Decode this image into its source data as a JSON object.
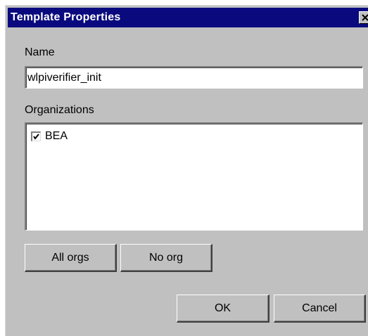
{
  "window": {
    "title": "Template Properties",
    "close_icon": "close-icon"
  },
  "form": {
    "name_label": "Name",
    "name_value": "wlpiverifier_init",
    "organizations_label": "Organizations",
    "organizations": [
      {
        "name": "BEA",
        "checked": true
      }
    ]
  },
  "buttons": {
    "all_orgs": "All orgs",
    "no_org": "No org",
    "ok": "OK",
    "cancel": "Cancel"
  },
  "colors": {
    "titlebar": "#0a0a7e",
    "dialog_bg": "#c0c0c0",
    "field_bg": "#ffffff"
  }
}
